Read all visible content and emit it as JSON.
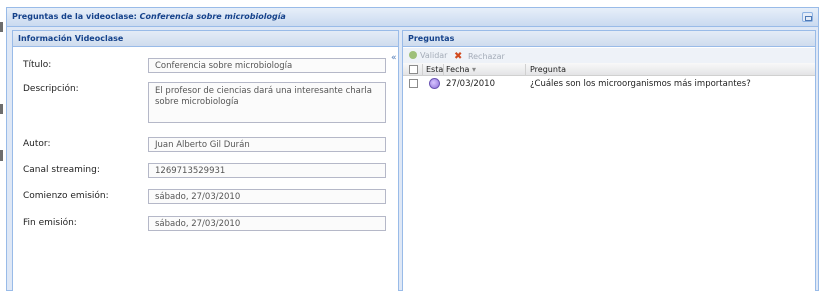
{
  "window": {
    "title_prefix": "Preguntas de la videoclase:",
    "title_subject": "Conferencia sobre microbiología"
  },
  "info_panel": {
    "title": "Información Videoclase",
    "fields": {
      "titulo": {
        "label": "Título:",
        "value": "Conferencia sobre microbiología"
      },
      "descripcion": {
        "label": "Descripción:",
        "value": "El profesor de ciencias dará una interesante charla sobre microbiología"
      },
      "autor": {
        "label": "Autor:",
        "value": "Juan Alberto Gil Durán"
      },
      "canal": {
        "label": "Canal streaming:",
        "value": "1269713529931"
      },
      "comienzo": {
        "label": "Comienzo emisión:",
        "value": "sábado, 27/03/2010"
      },
      "fin": {
        "label": "Fin emisión:",
        "value": "sábado, 27/03/2010"
      }
    }
  },
  "questions_panel": {
    "title": "Preguntas",
    "toolbar": {
      "validate_label": "Validar",
      "reject_label": "Rechazar"
    },
    "columns": {
      "status": "Esta",
      "date": "Fecha",
      "sort_indicator": "▾",
      "question": "Pregunta"
    },
    "rows": [
      {
        "date": "27/03/2010",
        "question": "¿Cuáles son los microorganismos más importantes?",
        "status_icon": "chat-bubble-icon"
      }
    ]
  },
  "colors": {
    "accent": "#15428b",
    "border": "#99bbe8",
    "panel_bg": "#dfe8f6",
    "reject": "#d24b1f",
    "validate": "#9fc07a"
  }
}
